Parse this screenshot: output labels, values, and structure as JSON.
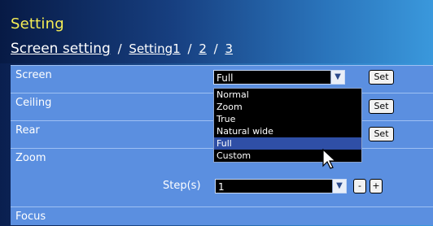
{
  "header": {
    "title": "Setting",
    "breadcrumb": {
      "current": "Screen setting",
      "separator": "/",
      "links": [
        "Setting1",
        "2",
        "3"
      ]
    }
  },
  "rows": {
    "screen": {
      "label": "Screen",
      "value": "Full",
      "button": "Set"
    },
    "ceiling": {
      "label": "Ceiling",
      "button": "Set"
    },
    "rear": {
      "label": "Rear",
      "button": "Set"
    },
    "zoom": {
      "label": "Zoom",
      "steps_label": "Step(s)",
      "steps_value": "1",
      "minus": "-",
      "plus": "+"
    },
    "focus": {
      "label": "Focus"
    }
  },
  "dropdown": {
    "options": [
      "Normal",
      "Zoom",
      "True",
      "Natural wide",
      "Full",
      "Custom"
    ],
    "selected_index": 4
  },
  "colors": {
    "title": "#f6ee55",
    "panel": "#5b8fe0",
    "highlight": "#2f4fa6"
  },
  "icons": [
    "chevron-down-icon",
    "mouse-pointer-icon"
  ]
}
